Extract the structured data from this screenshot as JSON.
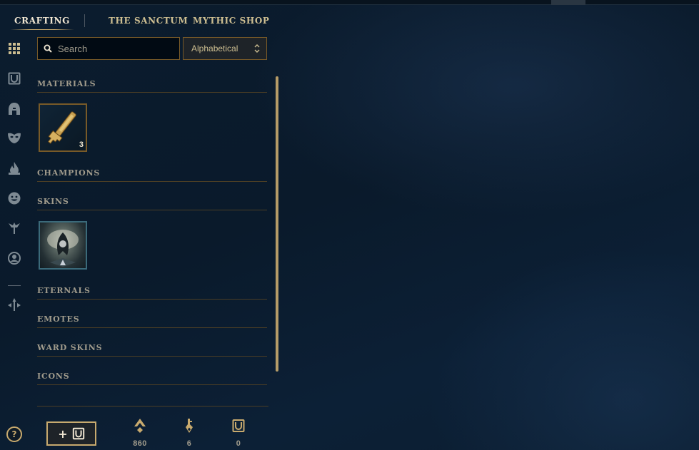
{
  "tabs": [
    {
      "label": "CRAFTING",
      "active": true
    },
    {
      "label": "THE SANCTUM",
      "active": false
    },
    {
      "label": "MYTHIC SHOP",
      "active": false
    }
  ],
  "sidebar": {
    "icons": [
      "grid-icon",
      "chest-icon",
      "helmet-icon",
      "mask-icon",
      "flame-icon",
      "emote-face-icon",
      "ward-icon",
      "profile-icon-icon",
      "direction-arrows-icon"
    ],
    "help_label": "?"
  },
  "search": {
    "placeholder": "Search",
    "value": ""
  },
  "sort": {
    "selected": "Alphabetical"
  },
  "sections": [
    {
      "label": "MATERIALS"
    },
    {
      "label": "CHAMPIONS"
    },
    {
      "label": "SKINS"
    },
    {
      "label": "ETERNALS"
    },
    {
      "label": "EMOTES"
    },
    {
      "label": "WARD SKINS"
    },
    {
      "label": "ICONS"
    }
  ],
  "materials": {
    "key_count": "3"
  },
  "footer": {
    "add_label": "+",
    "currencies": [
      {
        "icon": "orange-essence-icon",
        "value": "860"
      },
      {
        "icon": "key-fragment-icon",
        "value": "6"
      },
      {
        "icon": "chest-icon",
        "value": "0"
      }
    ]
  },
  "colors": {
    "gold": "#c8aa6e",
    "gold_dark": "#785a28",
    "text_muted": "#a09b8c",
    "background": "#0b1c2e"
  }
}
